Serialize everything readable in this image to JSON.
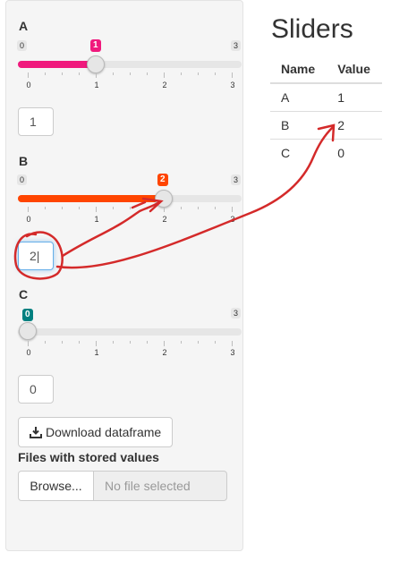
{
  "sliders": [
    {
      "label": "A",
      "min": "0",
      "max": "3",
      "value": 1,
      "value_text": "1",
      "accent": "#f0197d",
      "input_value": "1",
      "ticks": [
        "0",
        "1",
        "2",
        "3"
      ]
    },
    {
      "label": "B",
      "min": "0",
      "max": "3",
      "value": 2,
      "value_text": "2",
      "accent": "#ff4500",
      "input_value": "2|",
      "ticks": [
        "0",
        "1",
        "2",
        "3"
      ]
    },
    {
      "label": "C",
      "min": "0",
      "max": "3",
      "value": 0,
      "value_text": "0",
      "accent": "#008080",
      "input_value": "0",
      "ticks": [
        "0",
        "1",
        "2",
        "3"
      ]
    }
  ],
  "download_button": {
    "label": "Download dataframe",
    "icon": "download-icon"
  },
  "files": {
    "label": "Files with stored values",
    "browse_label": "Browse...",
    "placeholder": "No file selected"
  },
  "main": {
    "title": "Sliders",
    "table": {
      "headers": [
        "Name",
        "Value"
      ],
      "rows": [
        [
          "A",
          "1"
        ],
        [
          "B",
          "2"
        ],
        [
          "C",
          "0"
        ]
      ]
    }
  },
  "annotation_color": "#d42a2a"
}
